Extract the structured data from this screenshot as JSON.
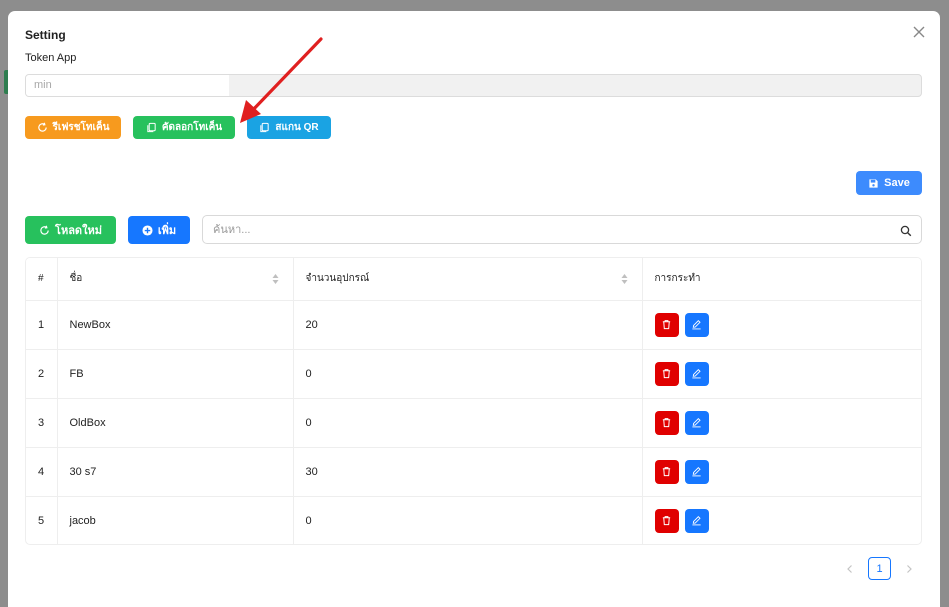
{
  "modal": {
    "title": "Setting",
    "token_label": "Token App",
    "token_value": "min"
  },
  "buttons": {
    "refresh_token": "รีเฟรชโทเค็น",
    "copy_token": "คัดลอกโทเค็น",
    "scan_qr": "สแกน QR",
    "save": "Save",
    "reload": "โหลดใหม่",
    "add": "เพิ่ม"
  },
  "search": {
    "placeholder": "ค้นหา..."
  },
  "table": {
    "headers": [
      "#",
      "ชื่อ",
      "จำนวนอุปกรณ์",
      "การกระทำ"
    ],
    "rows": [
      {
        "index": "1",
        "name": "NewBox",
        "devices": "20"
      },
      {
        "index": "2",
        "name": "FB",
        "devices": "0"
      },
      {
        "index": "3",
        "name": "OldBox",
        "devices": "0"
      },
      {
        "index": "4",
        "name": "30 s7",
        "devices": "30"
      },
      {
        "index": "5",
        "name": "jacob",
        "devices": "0"
      }
    ]
  },
  "pagination": {
    "current_page": "1"
  },
  "icons": {
    "close": "close-icon",
    "refresh": "refresh-icon",
    "copy": "copy-icon",
    "save": "save-icon",
    "add": "plus-circle-icon",
    "search": "search-icon",
    "sort": "sort-icon",
    "delete": "trash-icon",
    "edit": "edit-icon",
    "prev": "chevron-left-icon",
    "next": "chevron-right-icon",
    "annotation": "red-arrow-icon"
  },
  "colors": {
    "refresh": "#f79a1e",
    "copy": "#27c15d",
    "scan": "#1aa3e3",
    "save": "#3d8bfd",
    "reload": "#27c15d",
    "add": "#1677ff",
    "delete": "#e00000",
    "edit": "#1677ff",
    "arrow": "#e02020"
  }
}
